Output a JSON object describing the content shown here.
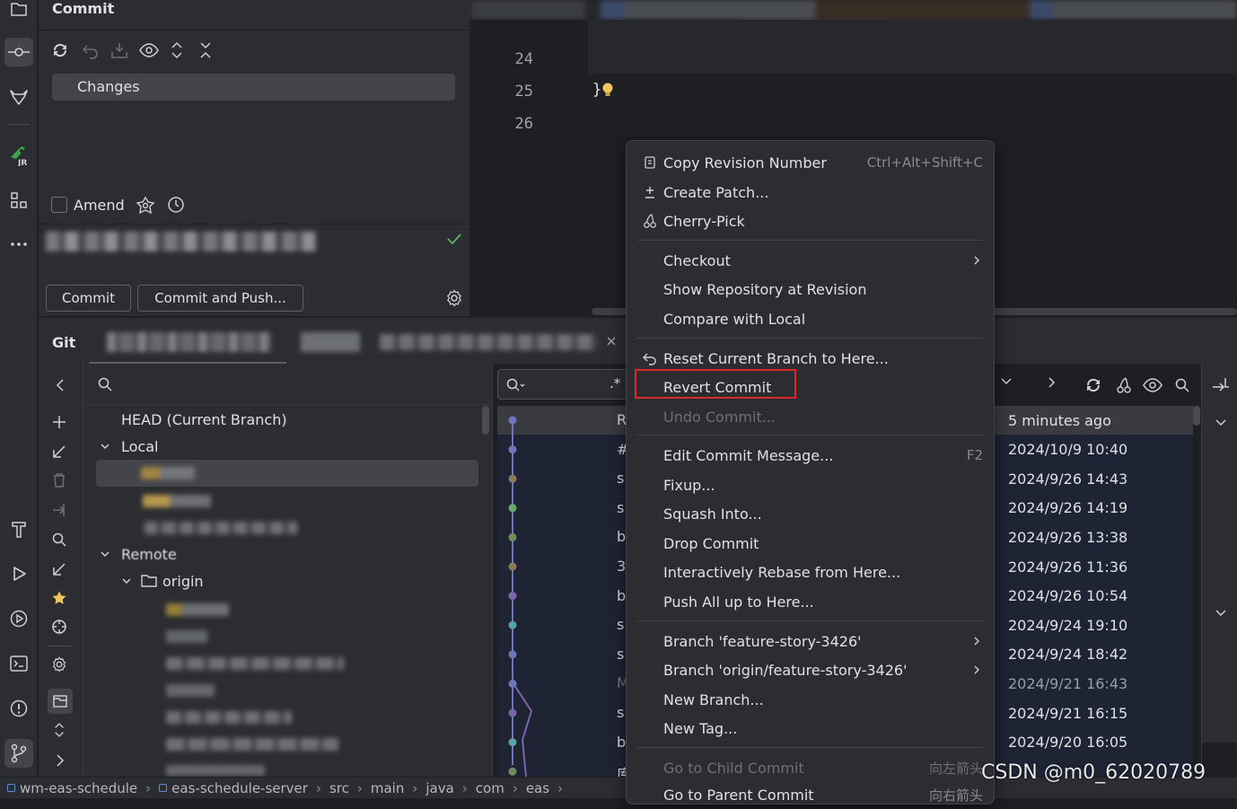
{
  "commit_panel": {
    "title": "Commit",
    "changes_label": "Changes",
    "amend_label": "Amend",
    "commit_button": "Commit",
    "commit_push_button": "Commit and Push..."
  },
  "editor": {
    "line_numbers": [
      "24",
      "25",
      "26"
    ],
    "code_line_25": "}"
  },
  "git": {
    "tab_label": "Git",
    "branches": {
      "head": "HEAD (Current Branch)",
      "local": "Local",
      "remote": "Remote",
      "origin": "origin"
    },
    "log_search_symbol": ".*",
    "dates": [
      "5 minutes ago",
      "2024/10/9 10:40",
      "2024/9/26 14:43",
      "2024/9/26 14:19",
      "2024/9/26 13:38",
      "2024/9/26 11:36",
      "2024/9/26 10:54",
      "2024/9/24 19:10",
      "2024/9/24 18:42",
      "2024/9/21 16:43",
      "2024/9/21 16:15",
      "2024/9/20 16:05"
    ],
    "subject_initials": [
      "R",
      "#",
      "s",
      "s",
      "b",
      "3",
      "b",
      "s",
      "s",
      "M",
      "s",
      "b",
      "库"
    ]
  },
  "context_menu": {
    "items": [
      {
        "label": "Copy Revision Number",
        "shortcut": "Ctrl+Alt+Shift+C",
        "icon": "copy-icon"
      },
      {
        "label": "Create Patch...",
        "icon": "patch-icon"
      },
      {
        "label": "Cherry-Pick",
        "icon": "cherry-icon"
      },
      {
        "label": "Checkout",
        "submenu": true
      },
      {
        "label": "Show Repository at Revision"
      },
      {
        "label": "Compare with Local"
      },
      {
        "label": "Reset Current Branch to Here...",
        "icon": "reset-icon"
      },
      {
        "label": "Revert Commit"
      },
      {
        "label": "Undo Commit...",
        "disabled": true
      },
      {
        "label": "Edit Commit Message...",
        "shortcut": "F2"
      },
      {
        "label": "Fixup..."
      },
      {
        "label": "Squash Into..."
      },
      {
        "label": "Drop Commit"
      },
      {
        "label": "Interactively Rebase from Here..."
      },
      {
        "label": "Push All up to Here..."
      },
      {
        "label": "Branch 'feature-story-3426'",
        "submenu": true
      },
      {
        "label": "Branch 'origin/feature-story-3426'",
        "submenu": true
      },
      {
        "label": "New Branch..."
      },
      {
        "label": "New Tag..."
      },
      {
        "label": "Go to Child Commit",
        "shortcut": "向左箭头",
        "disabled": true
      },
      {
        "label": "Go to Parent Commit",
        "shortcut": "向右箭头"
      }
    ]
  },
  "status_bar": {
    "breadcrumbs": [
      "wm-eas-schedule",
      "eas-schedule-server",
      "src",
      "main",
      "java",
      "com",
      "eas"
    ]
  },
  "watermark": "CSDN @m0_62020789",
  "colors": {
    "highlight_box": "#e0272c",
    "graph_colors": [
      "#6e76b8",
      "#8a7a5c",
      "#68a86a",
      "#6f8b62",
      "#7a66a8",
      "#5aa2a2"
    ]
  }
}
